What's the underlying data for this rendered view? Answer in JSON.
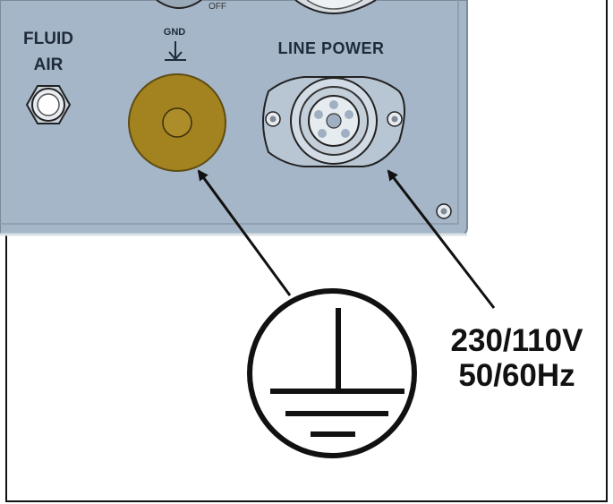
{
  "panel": {
    "fluid_label": "FLUID",
    "air_label": "AIR",
    "gnd_label": "GND",
    "line_power_label": "LINE POWER",
    "panel_color": "#a5b6c8",
    "gnd_terminal_color": "#a38320"
  },
  "callout": {
    "voltage": "230/110V",
    "frequency": "50/60Hz"
  },
  "icons": [
    "air-fitting-icon",
    "ground-terminal-icon",
    "power-connector-icon",
    "protective-earth-icon",
    "arrow-icon"
  ]
}
